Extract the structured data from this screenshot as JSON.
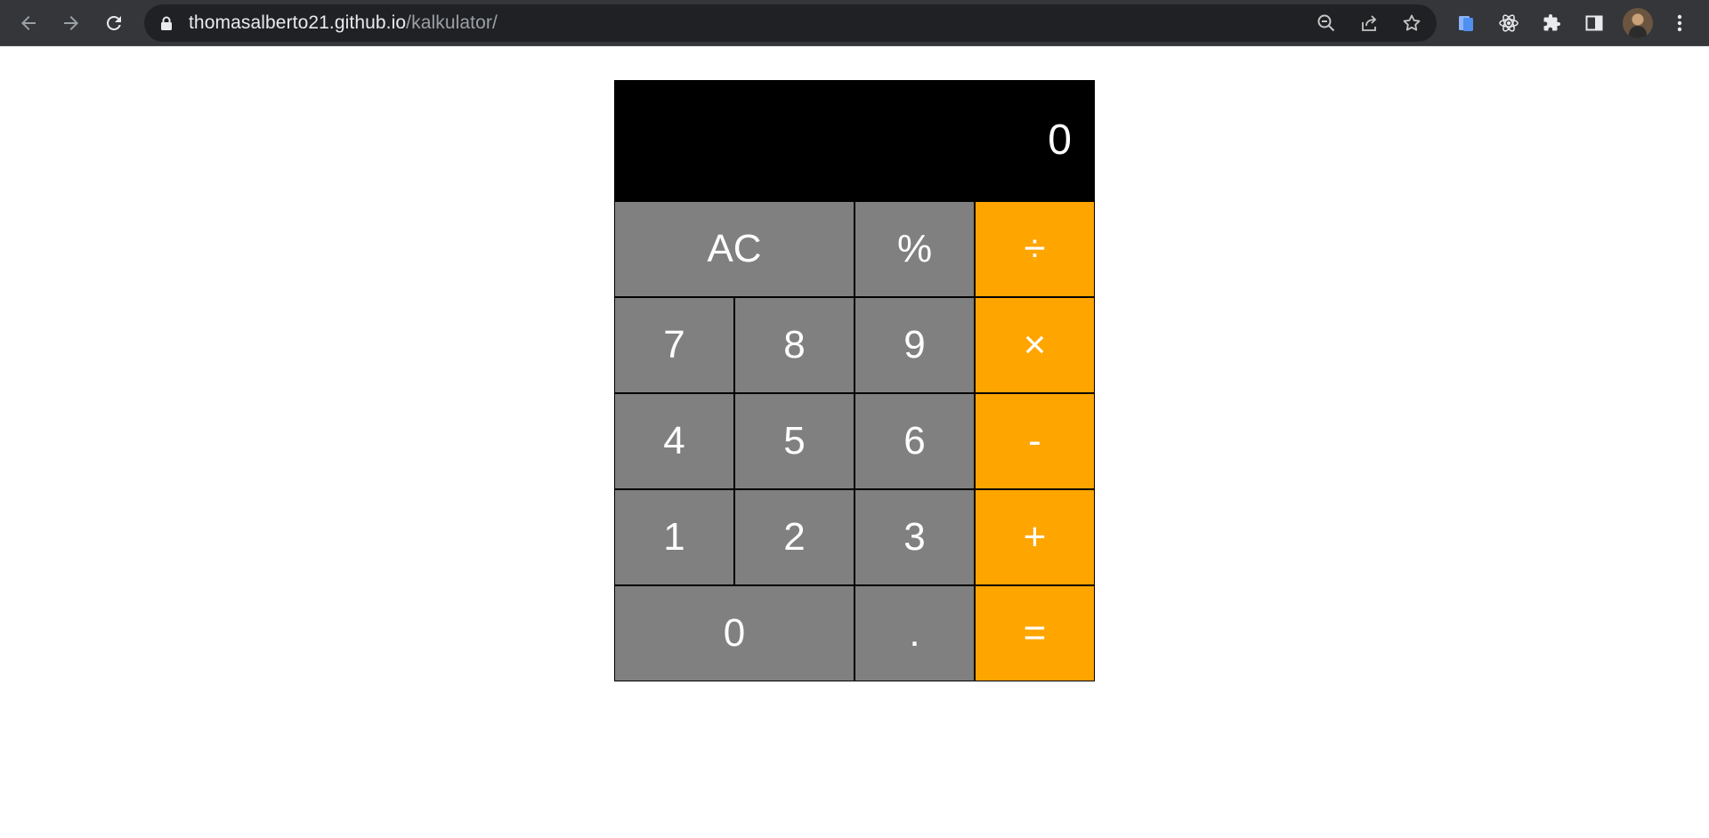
{
  "browser": {
    "url_host": "thomasalberto21.github.io",
    "url_path": "/kalkulator/",
    "icons": [
      "back-arrow-icon",
      "forward-arrow-icon",
      "reload-icon",
      "lock-icon",
      "zoom-out-icon",
      "share-icon",
      "bookmark-star-icon",
      "extension-file-icon",
      "react-devtools-icon",
      "extensions-puzzle-icon",
      "side-panel-icon",
      "avatar",
      "menu-kebab-icon"
    ]
  },
  "calculator": {
    "display": "0",
    "keys": {
      "ac": "AC",
      "percent": "%",
      "divide": "÷",
      "seven": "7",
      "eight": "8",
      "nine": "9",
      "multiply": "×",
      "four": "4",
      "five": "5",
      "six": "6",
      "subtract": "-",
      "one": "1",
      "two": "2",
      "three": "3",
      "add": "+",
      "zero": "0",
      "decimal": ".",
      "equals": "="
    },
    "colors": {
      "display_bg": "#000000",
      "number_key": "#808080",
      "operator_key": "#ffa500",
      "text": "#ffffff"
    }
  }
}
